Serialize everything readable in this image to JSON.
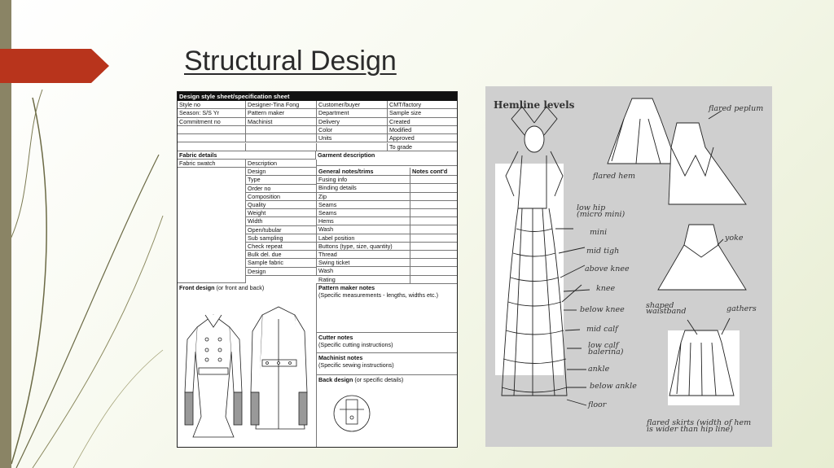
{
  "slide": {
    "title": "Structural Design",
    "accent_color": "#b8341c",
    "bar_color": "#8a8465"
  },
  "spec_sheet": {
    "header": "Design style sheet/specification sheet",
    "top_rows": [
      [
        "Style no",
        "Designer-Tina Fong",
        "Customer/buyer",
        "CMT/factory"
      ],
      [
        "Season: S/S Yr",
        "Pattern maker",
        "Department",
        "Sample size"
      ],
      [
        "Commitment no",
        "Machinist",
        "Delivery",
        "Created"
      ],
      [
        "",
        "",
        "Color",
        "Modified"
      ],
      [
        "",
        "",
        "Units",
        "Approved"
      ],
      [
        "",
        "",
        "",
        "To grade"
      ]
    ],
    "fabric_details": "Fabric details",
    "garment_description": "Garment description",
    "fabric_swatch": "Fabric swatch",
    "description_items": [
      "Description",
      "Design",
      "Type",
      "Order no",
      "Composition",
      "Quality",
      "Weight",
      "Width",
      "Open/tubular",
      "Sub sampling",
      "Check repeat",
      "Bulk del. due",
      "Sample fabric",
      "Design"
    ],
    "general_notes_header": "General notes/trims",
    "notes_contd": "Notes cont'd",
    "general_notes": [
      "Fusing info",
      "Binding details",
      "Zip",
      "Seams",
      "Seams",
      "Hems",
      "Wash",
      "Label position",
      "Buttons (type, size, quantity)",
      "Thread",
      "Swing ticket",
      "Wash",
      "Rating"
    ],
    "front_design": "Front design",
    "front_design_note": "(or front and back)",
    "pattern_maker_notes": "Pattern maker notes",
    "pattern_maker_sub": "(Specific measurements - lengths, widths etc.)",
    "cutter_notes": "Cutter notes",
    "cutter_sub": "(Specific cutting instructions)",
    "machinist_notes": "Machinist notes",
    "machinist_sub": "(Specific sewing instructions)",
    "back_design": "Back design",
    "back_design_note": "(or specific details)"
  },
  "hemline": {
    "title": "Hemline levels",
    "levels": [
      "low hip",
      "(micro mini)",
      "mini",
      "mid tigh",
      "above knee",
      "knee",
      "below knee",
      "mid calf",
      "low calf",
      "balerina)",
      "ankle",
      "below ankle",
      "floor"
    ],
    "flared_peplum": "flared peplum",
    "flared_hem": "flared hem",
    "yoke": "yoke",
    "shaped_waistband_1": "shaped",
    "shaped_waistband_2": "waistband",
    "gathers": "gathers",
    "flared_skirts_1": "flared skirts (width of hem",
    "flared_skirts_2": "is wider than hip line)"
  }
}
